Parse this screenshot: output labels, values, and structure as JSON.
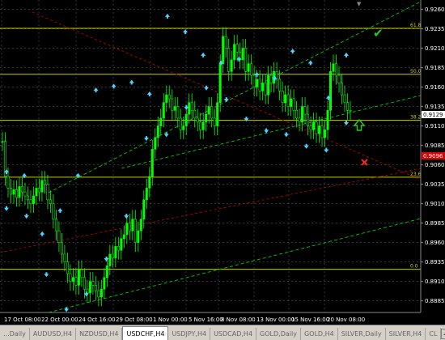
{
  "colors": {
    "background": "#000000",
    "grid": "#4a5a60",
    "candle_up": "#00ff00",
    "candle_down": "#00ff00",
    "fibo": "#cccc00",
    "channel": "#00cc00",
    "trendline": "#cc0000",
    "fractal_arrow": "#4fd2ff",
    "current_price_bg": "#ffffff",
    "red_price_bg": "#e00000",
    "checkmark": "#22cc22",
    "up_arrow": "#22cc22",
    "cross": "#ff2222"
  },
  "price_axis": {
    "labels": [
      "0.9260",
      "0.9235",
      "0.9210",
      "0.9185",
      "0.9160",
      "0.9135",
      "0.9110",
      "0.9085",
      "0.9060",
      "0.9035",
      "0.9010",
      "0.8985",
      "0.8960",
      "0.8935",
      "0.8910",
      "0.8885"
    ],
    "current_price": "0.9129",
    "red_price": "0.9096",
    "top_marker": "▼"
  },
  "time_axis": {
    "labels": [
      "17 Oct 08:00",
      "22 Oct 00:00",
      "24 Oct 16:00",
      "29 Oct 08:00",
      "1 Nov 00:00",
      "5 Nov 16:00",
      "8 Nov 08:00",
      "13 Nov 00:00",
      "15 Nov 16:00",
      "20 Nov 08:00"
    ]
  },
  "fibo_levels": [
    {
      "label": "61.8",
      "price": 0.92356
    },
    {
      "label": "50.0",
      "price": 0.91764
    },
    {
      "label": "38.2",
      "price": 0.91172
    },
    {
      "label": "23.6",
      "price": 0.9044
    },
    {
      "label": "0.0",
      "price": 0.89256
    }
  ],
  "icons": {
    "checkmark": "checkmark-icon",
    "up_arrow": "up-arrow-icon",
    "cross": "cross-icon",
    "fractal_up": "fractal-up-arrow-icon",
    "fractal_down": "fractal-down-arrow-icon"
  },
  "tabs": [
    {
      "label": "...Daily",
      "active": false
    },
    {
      "label": "AUDUSD,H4",
      "active": false
    },
    {
      "label": "NZDUSD,H4",
      "active": false
    },
    {
      "label": "USDCHF,H4",
      "active": true
    },
    {
      "label": "USDJPY,H4",
      "active": false
    },
    {
      "label": "USDCAD,H4",
      "active": false
    },
    {
      "label": "GOLD,Daily",
      "active": false
    },
    {
      "label": "GOLD,H4",
      "active": false
    },
    {
      "label": "SILVER,Daily",
      "active": false
    },
    {
      "label": "SILVER,H4",
      "active": false
    },
    {
      "label": "CL",
      "active": false
    }
  ],
  "scroll_buttons": {
    "left": "◄",
    "right": "►"
  },
  "chart_data": {
    "type": "candlestick",
    "symbol": "USDCHF",
    "timeframe": "H4",
    "ylim": [
      0.887,
      0.9272
    ],
    "x_tick_labels": [
      "17 Oct 08:00",
      "22 Oct 00:00",
      "24 Oct 16:00",
      "29 Oct 08:00",
      "1 Nov 00:00",
      "5 Nov 16:00",
      "8 Nov 08:00",
      "13 Nov 00:00",
      "15 Nov 16:00",
      "20 Nov 08:00"
    ],
    "close": [
      0.909,
      0.9045,
      0.903,
      0.9022,
      0.9028,
      0.9018,
      0.9032,
      0.9025,
      0.902,
      0.9015,
      0.901,
      0.902,
      0.903,
      0.9025,
      0.904,
      0.9035,
      0.9015,
      0.901,
      0.899,
      0.8975,
      0.896,
      0.8945,
      0.8935,
      0.892,
      0.891,
      0.8915,
      0.8905,
      0.8925,
      0.8915,
      0.89,
      0.8895,
      0.891,
      0.8905,
      0.8898,
      0.889,
      0.89,
      0.8915,
      0.893,
      0.8945,
      0.894,
      0.8955,
      0.895,
      0.8965,
      0.897,
      0.8985,
      0.8975,
      0.899,
      0.896,
      0.8975,
      0.899,
      0.9015,
      0.903,
      0.9045,
      0.908,
      0.9095,
      0.911,
      0.912,
      0.914,
      0.915,
      0.9145,
      0.913,
      0.9135,
      0.912,
      0.9105,
      0.911,
      0.9125,
      0.914,
      0.913,
      0.912,
      0.9115,
      0.9105,
      0.9115,
      0.9125,
      0.9135,
      0.912,
      0.911,
      0.914,
      0.919,
      0.9225,
      0.921,
      0.918,
      0.9195,
      0.9215,
      0.9205,
      0.9195,
      0.921,
      0.918,
      0.919,
      0.9175,
      0.916,
      0.917,
      0.9155,
      0.9165,
      0.915,
      0.9175,
      0.9165,
      0.918,
      0.917,
      0.9155,
      0.914,
      0.915,
      0.9135,
      0.9145,
      0.913,
      0.912,
      0.9115,
      0.9135,
      0.9125,
      0.911,
      0.9105,
      0.9115,
      0.91,
      0.911,
      0.9095,
      0.9105,
      0.913,
      0.918,
      0.919,
      0.9175,
      0.9165,
      0.915,
      0.914,
      0.913,
      0.9129
    ],
    "fractals_up": [
      0.9045,
      0.904,
      0.8965,
      0.8995,
      0.904,
      0.915,
      0.9155,
      0.916,
      0.9145,
      0.9245,
      0.9225,
      0.9195,
      0.9185,
      0.919,
      0.917,
      0.9165,
      0.92,
      0.9185,
      0.914,
      0.9195
    ],
    "fractals_down": [
      0.901,
      0.9,
      0.8925,
      0.888,
      0.89,
      0.8945,
      0.9,
      0.91,
      0.9105,
      0.914,
      0.9165,
      0.915,
      0.9125,
      0.911,
      0.9105,
      0.909,
      0.9085,
      0.912
    ]
  }
}
